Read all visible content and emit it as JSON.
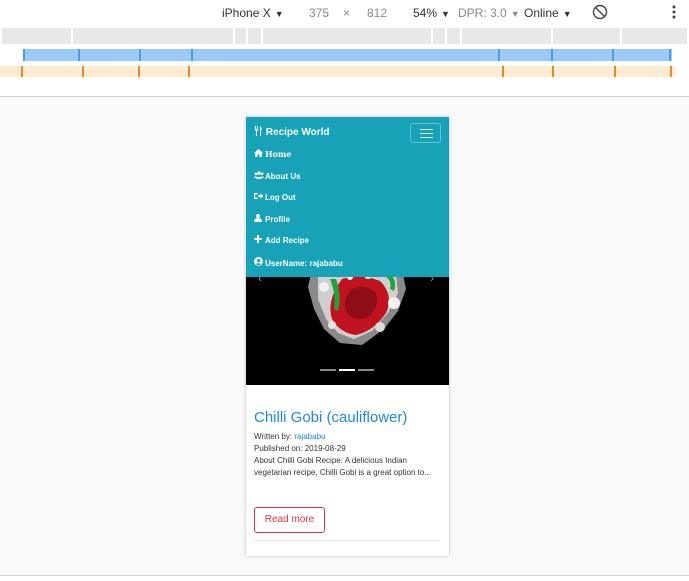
{
  "devtools": {
    "device": "iPhone X",
    "width": "375",
    "times": "×",
    "height": "812",
    "zoom": "54%",
    "dpr": "DPR: 3.0",
    "throttle": "Online",
    "caret": "▼",
    "rotate_icon": "rotate-icon",
    "more_icon": "more-icon"
  },
  "navbar": {
    "brand": "Recipe World",
    "brand_icon": "utensils-icon",
    "items": [
      {
        "label": "Home",
        "icon": "home-icon"
      },
      {
        "label": "About Us",
        "icon": "users-icon"
      },
      {
        "label": "Log Out",
        "icon": "sign-out-icon"
      },
      {
        "label": "Profile",
        "icon": "user-icon"
      },
      {
        "label": "Add Recipe",
        "icon": "plus-icon"
      },
      {
        "label": "UserName: rajababu",
        "icon": "user-circle-icon"
      }
    ]
  },
  "recipe": {
    "title": "Chilli Gobi (cauliflower)",
    "written_by_label": "Written by:",
    "author": "rajababu",
    "published_label": "Published on:",
    "published_date": "2019-08-29",
    "description": "About Chilli Gobi Recipe: A delicious Indian vegetarian recipe, Chilli Gobi is a great option to...",
    "read_more": "Read more"
  },
  "colors": {
    "navbar": "#17a2b8",
    "link": "#1e87e5",
    "danger": "#dc3545"
  }
}
